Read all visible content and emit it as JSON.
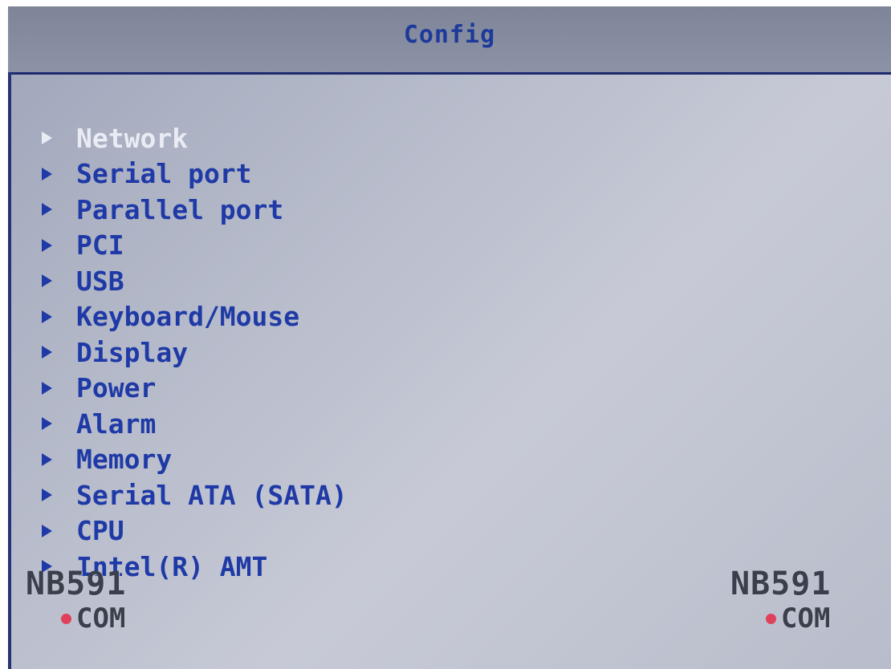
{
  "title": "Config",
  "menu": {
    "items": [
      {
        "label": "Network",
        "selected": true
      },
      {
        "label": "Serial port"
      },
      {
        "label": "Parallel port"
      },
      {
        "label": "PCI"
      },
      {
        "label": "USB"
      },
      {
        "label": "Keyboard/Mouse"
      },
      {
        "label": "Display"
      },
      {
        "label": "Power"
      },
      {
        "label": "Alarm"
      },
      {
        "label": "Memory"
      },
      {
        "label": "Serial ATA (SATA)"
      },
      {
        "label": "CPU"
      },
      {
        "label": "Intel(R) AMT"
      }
    ]
  },
  "watermark": {
    "line1": "NB591",
    "line2": "COM"
  },
  "colors": {
    "text_normal": "#1f3aa6",
    "text_selected": "#e9ecf3",
    "background": "#b4b9c9",
    "header_rule": "#1e2a6e"
  }
}
